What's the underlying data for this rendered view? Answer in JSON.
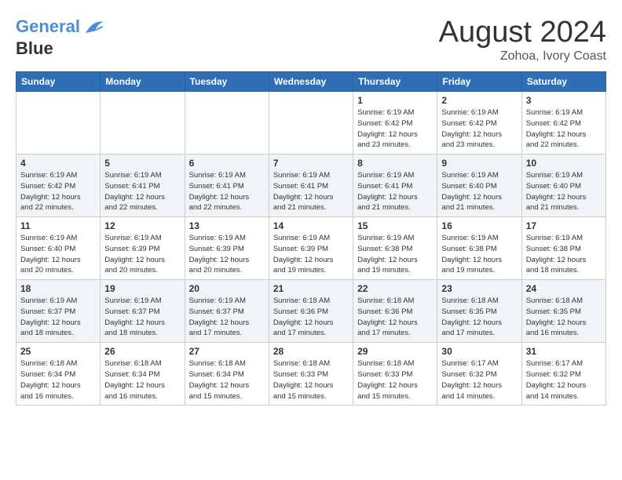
{
  "header": {
    "logo_line1": "General",
    "logo_line2": "Blue",
    "month": "August 2024",
    "location": "Zohoa, Ivory Coast"
  },
  "days_of_week": [
    "Sunday",
    "Monday",
    "Tuesday",
    "Wednesday",
    "Thursday",
    "Friday",
    "Saturday"
  ],
  "weeks": [
    [
      {
        "day": "",
        "info": ""
      },
      {
        "day": "",
        "info": ""
      },
      {
        "day": "",
        "info": ""
      },
      {
        "day": "",
        "info": ""
      },
      {
        "day": "1",
        "info": "Sunrise: 6:19 AM\nSunset: 6:42 PM\nDaylight: 12 hours\nand 23 minutes."
      },
      {
        "day": "2",
        "info": "Sunrise: 6:19 AM\nSunset: 6:42 PM\nDaylight: 12 hours\nand 23 minutes."
      },
      {
        "day": "3",
        "info": "Sunrise: 6:19 AM\nSunset: 6:42 PM\nDaylight: 12 hours\nand 22 minutes."
      }
    ],
    [
      {
        "day": "4",
        "info": "Sunrise: 6:19 AM\nSunset: 6:42 PM\nDaylight: 12 hours\nand 22 minutes."
      },
      {
        "day": "5",
        "info": "Sunrise: 6:19 AM\nSunset: 6:41 PM\nDaylight: 12 hours\nand 22 minutes."
      },
      {
        "day": "6",
        "info": "Sunrise: 6:19 AM\nSunset: 6:41 PM\nDaylight: 12 hours\nand 22 minutes."
      },
      {
        "day": "7",
        "info": "Sunrise: 6:19 AM\nSunset: 6:41 PM\nDaylight: 12 hours\nand 21 minutes."
      },
      {
        "day": "8",
        "info": "Sunrise: 6:19 AM\nSunset: 6:41 PM\nDaylight: 12 hours\nand 21 minutes."
      },
      {
        "day": "9",
        "info": "Sunrise: 6:19 AM\nSunset: 6:40 PM\nDaylight: 12 hours\nand 21 minutes."
      },
      {
        "day": "10",
        "info": "Sunrise: 6:19 AM\nSunset: 6:40 PM\nDaylight: 12 hours\nand 21 minutes."
      }
    ],
    [
      {
        "day": "11",
        "info": "Sunrise: 6:19 AM\nSunset: 6:40 PM\nDaylight: 12 hours\nand 20 minutes."
      },
      {
        "day": "12",
        "info": "Sunrise: 6:19 AM\nSunset: 6:39 PM\nDaylight: 12 hours\nand 20 minutes."
      },
      {
        "day": "13",
        "info": "Sunrise: 6:19 AM\nSunset: 6:39 PM\nDaylight: 12 hours\nand 20 minutes."
      },
      {
        "day": "14",
        "info": "Sunrise: 6:19 AM\nSunset: 6:39 PM\nDaylight: 12 hours\nand 19 minutes."
      },
      {
        "day": "15",
        "info": "Sunrise: 6:19 AM\nSunset: 6:38 PM\nDaylight: 12 hours\nand 19 minutes."
      },
      {
        "day": "16",
        "info": "Sunrise: 6:19 AM\nSunset: 6:38 PM\nDaylight: 12 hours\nand 19 minutes."
      },
      {
        "day": "17",
        "info": "Sunrise: 6:19 AM\nSunset: 6:38 PM\nDaylight: 12 hours\nand 18 minutes."
      }
    ],
    [
      {
        "day": "18",
        "info": "Sunrise: 6:19 AM\nSunset: 6:37 PM\nDaylight: 12 hours\nand 18 minutes."
      },
      {
        "day": "19",
        "info": "Sunrise: 6:19 AM\nSunset: 6:37 PM\nDaylight: 12 hours\nand 18 minutes."
      },
      {
        "day": "20",
        "info": "Sunrise: 6:19 AM\nSunset: 6:37 PM\nDaylight: 12 hours\nand 17 minutes."
      },
      {
        "day": "21",
        "info": "Sunrise: 6:18 AM\nSunset: 6:36 PM\nDaylight: 12 hours\nand 17 minutes."
      },
      {
        "day": "22",
        "info": "Sunrise: 6:18 AM\nSunset: 6:36 PM\nDaylight: 12 hours\nand 17 minutes."
      },
      {
        "day": "23",
        "info": "Sunrise: 6:18 AM\nSunset: 6:35 PM\nDaylight: 12 hours\nand 17 minutes."
      },
      {
        "day": "24",
        "info": "Sunrise: 6:18 AM\nSunset: 6:35 PM\nDaylight: 12 hours\nand 16 minutes."
      }
    ],
    [
      {
        "day": "25",
        "info": "Sunrise: 6:18 AM\nSunset: 6:34 PM\nDaylight: 12 hours\nand 16 minutes."
      },
      {
        "day": "26",
        "info": "Sunrise: 6:18 AM\nSunset: 6:34 PM\nDaylight: 12 hours\nand 16 minutes."
      },
      {
        "day": "27",
        "info": "Sunrise: 6:18 AM\nSunset: 6:34 PM\nDaylight: 12 hours\nand 15 minutes."
      },
      {
        "day": "28",
        "info": "Sunrise: 6:18 AM\nSunset: 6:33 PM\nDaylight: 12 hours\nand 15 minutes."
      },
      {
        "day": "29",
        "info": "Sunrise: 6:18 AM\nSunset: 6:33 PM\nDaylight: 12 hours\nand 15 minutes."
      },
      {
        "day": "30",
        "info": "Sunrise: 6:17 AM\nSunset: 6:32 PM\nDaylight: 12 hours\nand 14 minutes."
      },
      {
        "day": "31",
        "info": "Sunrise: 6:17 AM\nSunset: 6:32 PM\nDaylight: 12 hours\nand 14 minutes."
      }
    ]
  ]
}
